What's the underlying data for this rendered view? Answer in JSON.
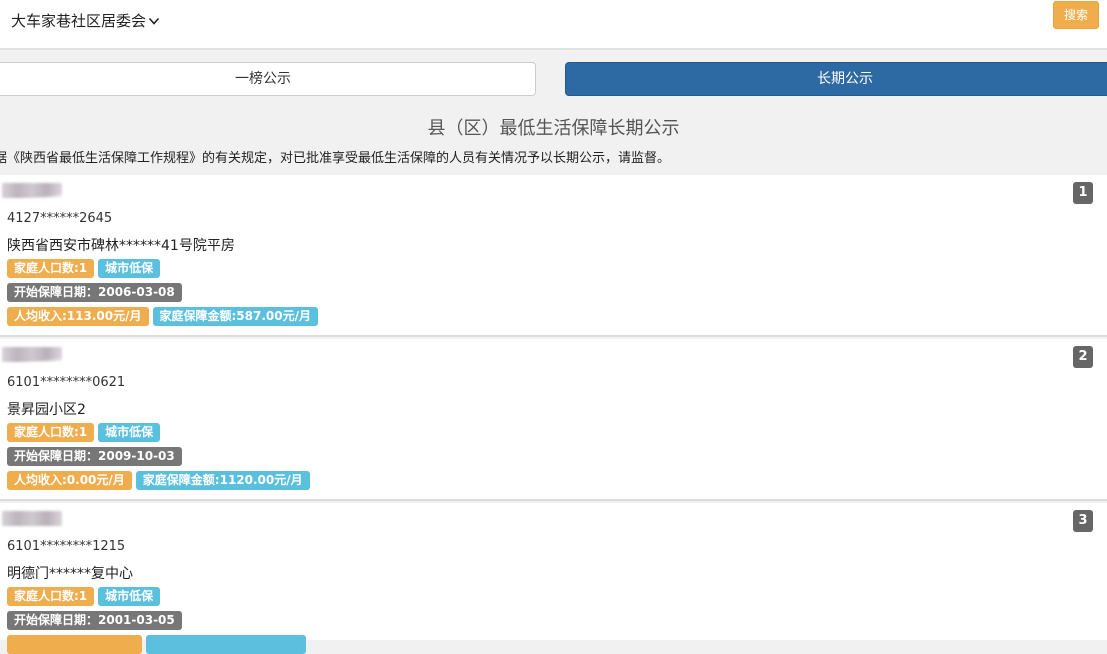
{
  "header": {
    "community": "大车家巷社区居委会",
    "search_label": "搜索"
  },
  "tabs": [
    {
      "label": "一榜公示",
      "active": false
    },
    {
      "label": "长期公示",
      "active": true
    }
  ],
  "title": "县（区）最低生活保障长期公示",
  "notice": "据《陕西省最低生活保障工作规程》的有关规定，对已批准享受最低生活保障的人员有关情况予以长期公示，请监督。",
  "records": [
    {
      "rank": "1",
      "id_no": "4127******2645",
      "address": "陕西省西安市碑林******41号院平房",
      "household": "家庭人口数:1",
      "type": "城市低保",
      "start_date": "开始保障日期：2006-03-08",
      "income": "人均收入:113.00元/月",
      "amount": "家庭保障金额:587.00元/月"
    },
    {
      "rank": "2",
      "id_no": "6101********0621",
      "address": "景昇园小区2",
      "household": "家庭人口数:1",
      "type": "城市低保",
      "start_date": "开始保障日期：2009-10-03",
      "income": "人均收入:0.00元/月",
      "amount": "家庭保障金额:1120.00元/月"
    },
    {
      "rank": "3",
      "id_no": "6101********1215",
      "address": "明德门******复中心",
      "household": "家庭人口数:1",
      "type": "城市低保",
      "start_date": "开始保障日期：2001-03-05",
      "income": "",
      "amount": ""
    }
  ],
  "colors": {
    "tab_active": "#2d6aa3",
    "badge_orange": "#f0ad4e",
    "badge_blue": "#5bc0de",
    "badge_gray": "#777777"
  }
}
